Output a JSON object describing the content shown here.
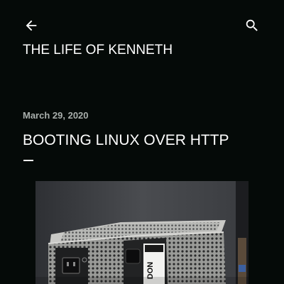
{
  "header": {
    "back_icon": "arrow-back-icon",
    "search_icon": "search-icon",
    "blog_title": "THE LIFE OF KENNETH"
  },
  "post": {
    "date": "March 29, 2020",
    "title": "BOOTING LINUX OVER HTTP",
    "image_text": "DON"
  },
  "colors": {
    "background": "#050a08",
    "text": "#ffffff",
    "date_text": "#a9afac"
  }
}
